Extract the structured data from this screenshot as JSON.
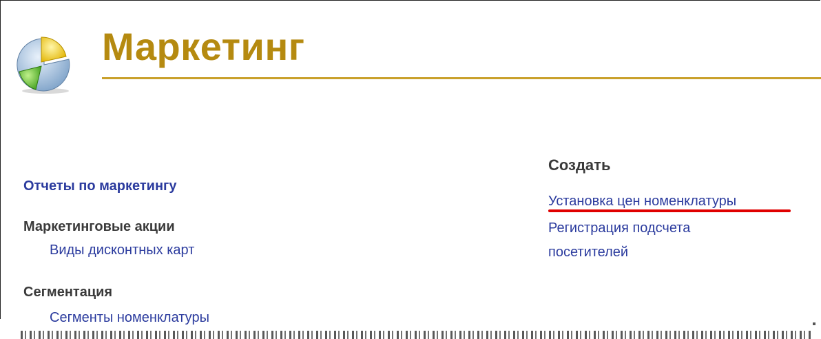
{
  "header": {
    "title": "Маркетинг"
  },
  "left": {
    "reports_link": "Отчеты по маркетингу",
    "promotions_heading": "Маркетинговые акции",
    "discount_cards_link": "Виды дисконтных карт",
    "segmentation_heading": "Сегментация",
    "item_segments_link": "Сегменты номенклатуры"
  },
  "right": {
    "create_heading": "Создать",
    "price_setting_link": "Установка цен номенклатуры",
    "visitor_count_line1": "Регистрация подсчета",
    "visitor_count_line2": "посетителей"
  },
  "colors": {
    "title": "#b58a10",
    "link": "#2b3b9e",
    "highlight": "#e00000"
  },
  "icons": {
    "logo": "pie-chart-icon"
  }
}
